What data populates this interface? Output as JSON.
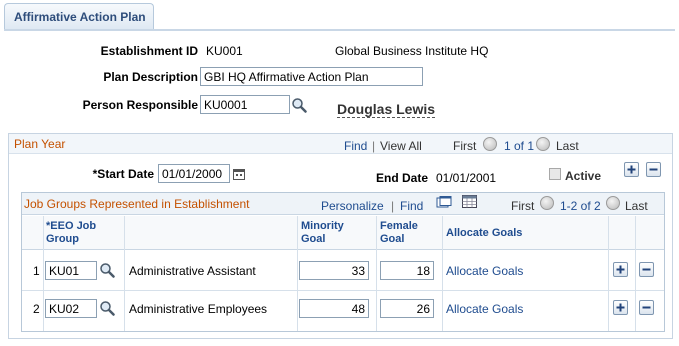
{
  "tab": {
    "label": "Affirmative Action Plan"
  },
  "header": {
    "establishment_id_label": "Establishment ID",
    "establishment_id_value": "KU001",
    "establishment_name": "Global Business Institute HQ",
    "plan_description_label": "Plan Description",
    "plan_description_value": "GBI HQ Affirmative Action Plan",
    "person_responsible_label": "Person Responsible",
    "person_responsible_value": "KU0001",
    "person_name": "Douglas Lewis"
  },
  "plan_year": {
    "title": "Plan Year",
    "find": "Find",
    "separator": "|",
    "view_all": "View All",
    "first": "First",
    "range": "1 of 1",
    "last": "Last",
    "start_date_label": "*Start Date",
    "start_date_value": "01/01/2000",
    "end_date_label": "End Date",
    "end_date_value": "01/01/2001",
    "active_label": "Active"
  },
  "job_groups": {
    "title": "Job Groups Represented in Establishment",
    "personalize": "Personalize",
    "separator": "|",
    "find": "Find",
    "first": "First",
    "range": "1-2 of 2",
    "last": "Last",
    "columns": {
      "eeo_job_group_line1": "*EEO Job",
      "eeo_job_group_line2": "Group",
      "minority_goal_line1": "Minority",
      "minority_goal_line2": "Goal",
      "female_goal_line1": "Female",
      "female_goal_line2": "Goal",
      "allocate_goals": "Allocate Goals"
    },
    "rows": [
      {
        "num": "1",
        "code": "KU01",
        "description": "Administrative Assistant",
        "minority": "33",
        "female": "18",
        "allocate": "Allocate Goals"
      },
      {
        "num": "2",
        "code": "KU02",
        "description": "Administrative Employees",
        "minority": "48",
        "female": "26",
        "allocate": "Allocate Goals"
      }
    ]
  }
}
